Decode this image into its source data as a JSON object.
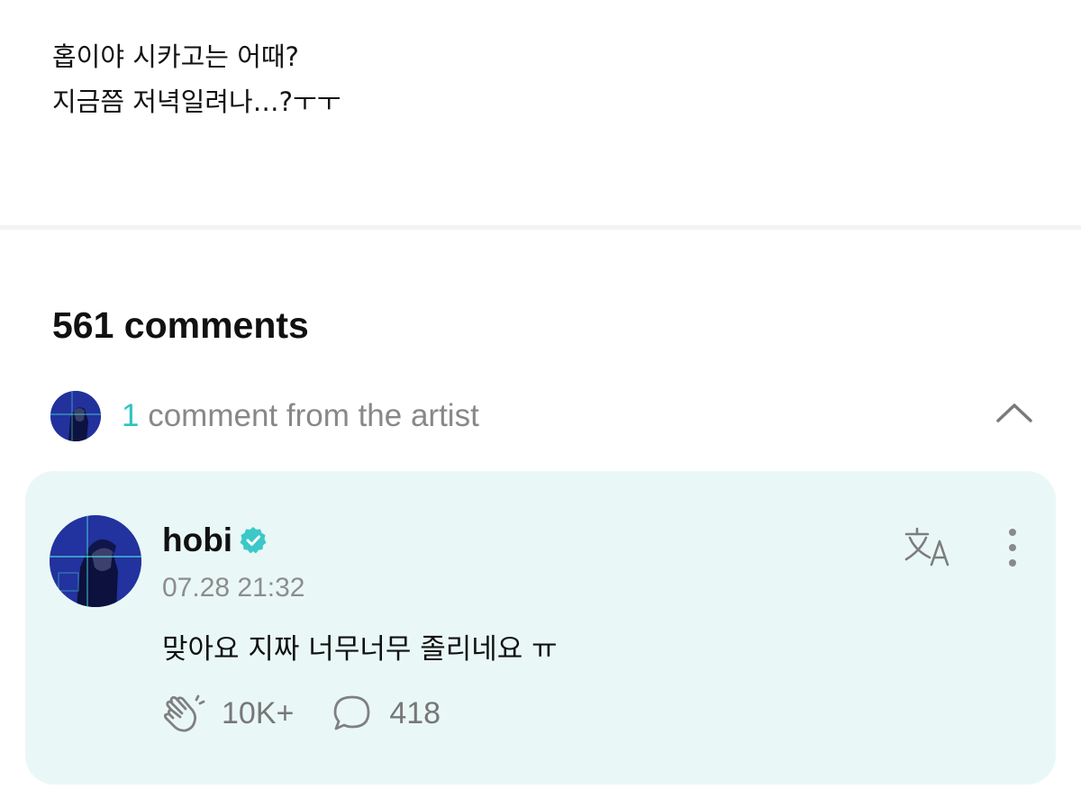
{
  "post": {
    "lines": [
      "홉이야 시카고는 어때?",
      "지금쯤 저녁일려나…?ㅜㅜ"
    ]
  },
  "comments": {
    "count_label": "561 comments"
  },
  "artist_section": {
    "count": "1",
    "label": "comment from the artist"
  },
  "artist_comment": {
    "username": "hobi",
    "timestamp": "07.28 21:32",
    "text": "맞아요 지짜 너무너무 졸리네요 ㅠ",
    "likes": "10K+",
    "replies": "418"
  },
  "icons": {
    "verified": "verified-badge-icon",
    "translate": "translate-icon",
    "more": "more-vertical-icon",
    "like": "clap-icon",
    "reply": "speech-bubble-icon",
    "collapse": "chevron-up-icon"
  },
  "colors": {
    "accent": "#2fc4c4",
    "card_bg": "#e9f8f6",
    "muted": "#888888"
  }
}
